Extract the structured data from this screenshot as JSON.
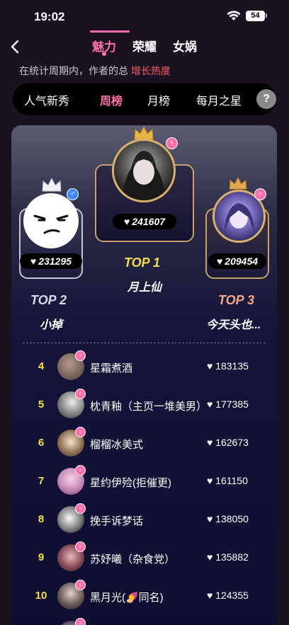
{
  "status_bar": {
    "time": "19:02",
    "battery": "54"
  },
  "top_tabs": [
    {
      "label": "魅力",
      "active": true
    },
    {
      "label": "荣耀",
      "active": false
    },
    {
      "label": "女娲",
      "active": false
    }
  ],
  "subtitle": {
    "text": "在统计周期内，作者的总 ",
    "highlight": "增长热度"
  },
  "period_tabs": [
    {
      "label": "人气新秀",
      "active": false
    },
    {
      "label": "周榜",
      "active": true
    },
    {
      "label": "月榜",
      "active": false
    },
    {
      "label": "每月之星",
      "active": false
    }
  ],
  "help_label": "?",
  "podium": {
    "top1": {
      "rank_label": "TOP 1",
      "name": "月上仙",
      "score": "241607",
      "gender": "female"
    },
    "top2": {
      "rank_label": "TOP 2",
      "name": "小掉",
      "score": "231295",
      "gender": "male"
    },
    "top3": {
      "rank_label": "TOP 3",
      "name": "今天头也...",
      "score": "209454",
      "gender": "female"
    }
  },
  "list": [
    {
      "rank": "4",
      "name": "星霜煮酒",
      "score": "183135"
    },
    {
      "rank": "5",
      "name": "枕青釉（主页一堆美男）",
      "score": "177385"
    },
    {
      "rank": "6",
      "name": "榴榴冰美式",
      "score": "162673"
    },
    {
      "rank": "7",
      "name": "星约伊殓(拒催更)",
      "score": "161150"
    },
    {
      "rank": "8",
      "name": "挽手诉梦话",
      "score": "138050"
    },
    {
      "rank": "9",
      "name": "苏妤曦（杂食党）",
      "score": "135882"
    },
    {
      "rank": "10",
      "name": "黑月光(🍠同名)",
      "score": "124355"
    }
  ],
  "colors": {
    "accent": "#ff6fa9",
    "highlight": "#ff5a6b",
    "gold": "#d9b16a",
    "rank_yellow": "#f5e23c"
  },
  "icons": {
    "heart": "♥",
    "female": "♀",
    "male": "♂"
  }
}
